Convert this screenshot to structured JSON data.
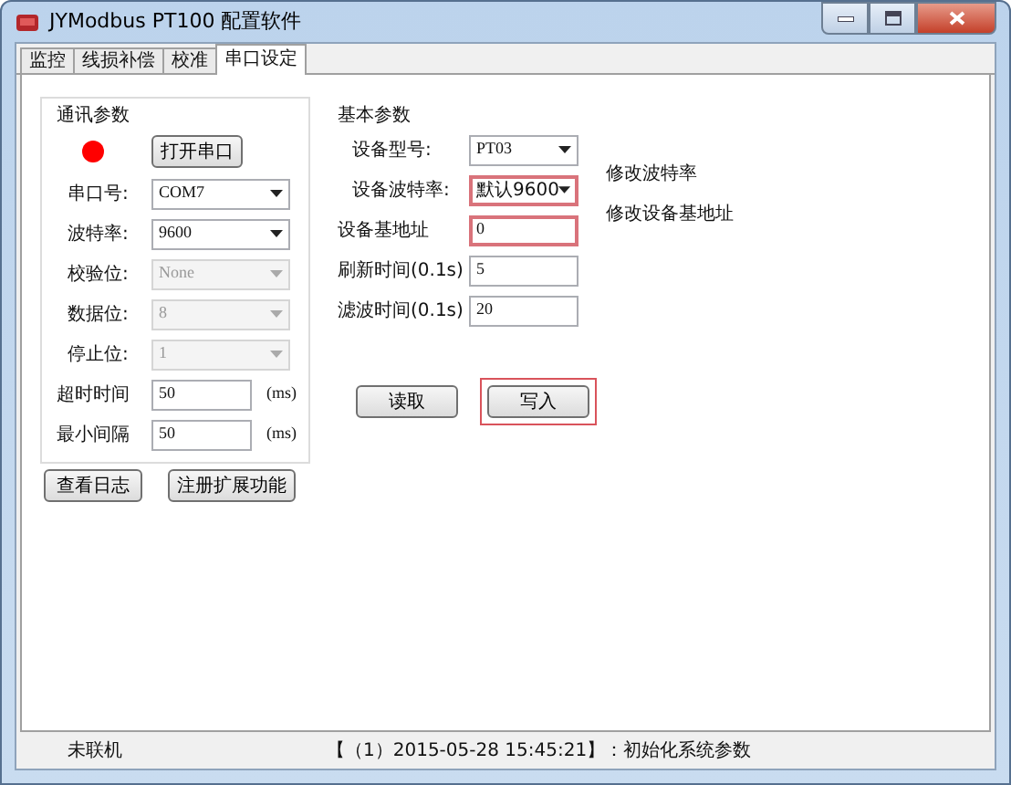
{
  "window": {
    "title": "JYModbus  PT100 配置软件"
  },
  "tabs": [
    {
      "label": "监控",
      "selected": false
    },
    {
      "label": "线损补偿",
      "selected": false
    },
    {
      "label": "校准",
      "selected": false
    },
    {
      "label": "串口设定",
      "selected": true
    }
  ],
  "comm_group": {
    "title": "通讯参数",
    "port_open": false,
    "open_button": "打开串口",
    "fields": [
      {
        "label": "串口号:",
        "value": "COM7",
        "kind": "select",
        "disabled": false
      },
      {
        "label": "波特率:",
        "value": "9600",
        "kind": "select",
        "disabled": false
      },
      {
        "label": "校验位:",
        "value": "None",
        "kind": "select",
        "disabled": true
      },
      {
        "label": "数据位:",
        "value": "8",
        "kind": "select",
        "disabled": true
      },
      {
        "label": "停止位:",
        "value": "1",
        "kind": "select",
        "disabled": true
      },
      {
        "label": "超时时间",
        "value": "50",
        "kind": "input",
        "disabled": false,
        "unit": "(ms)"
      },
      {
        "label": "最小间隔",
        "value": "50",
        "kind": "input",
        "disabled": false,
        "unit": "(ms)"
      }
    ]
  },
  "left_buttons": [
    "查看日志",
    "注册扩展功能"
  ],
  "basic_group": {
    "title": "基本参数",
    "fields": [
      {
        "label": "设备型号:",
        "value": "PT03",
        "kind": "select",
        "highlighted": false
      },
      {
        "label": "设备波特率:",
        "value": "默认9600",
        "kind": "select",
        "highlighted": true,
        "note": "修改波特率"
      },
      {
        "label": "设备基地址",
        "value": "0",
        "kind": "input",
        "highlighted": true,
        "note": "修改设备基地址"
      },
      {
        "label": "刷新时间(0.1s)",
        "value": "5",
        "kind": "input",
        "highlighted": false
      },
      {
        "label": "滤波时间(0.1s)",
        "value": "20",
        "kind": "input",
        "highlighted": false
      }
    ],
    "buttons": [
      {
        "label": "读取",
        "highlighted": false
      },
      {
        "label": "写入",
        "highlighted": true
      }
    ]
  },
  "status_bar": {
    "connection": "未联机",
    "message": "【（1）2015-05-28 15:45:21】：初始化系统参数"
  }
}
